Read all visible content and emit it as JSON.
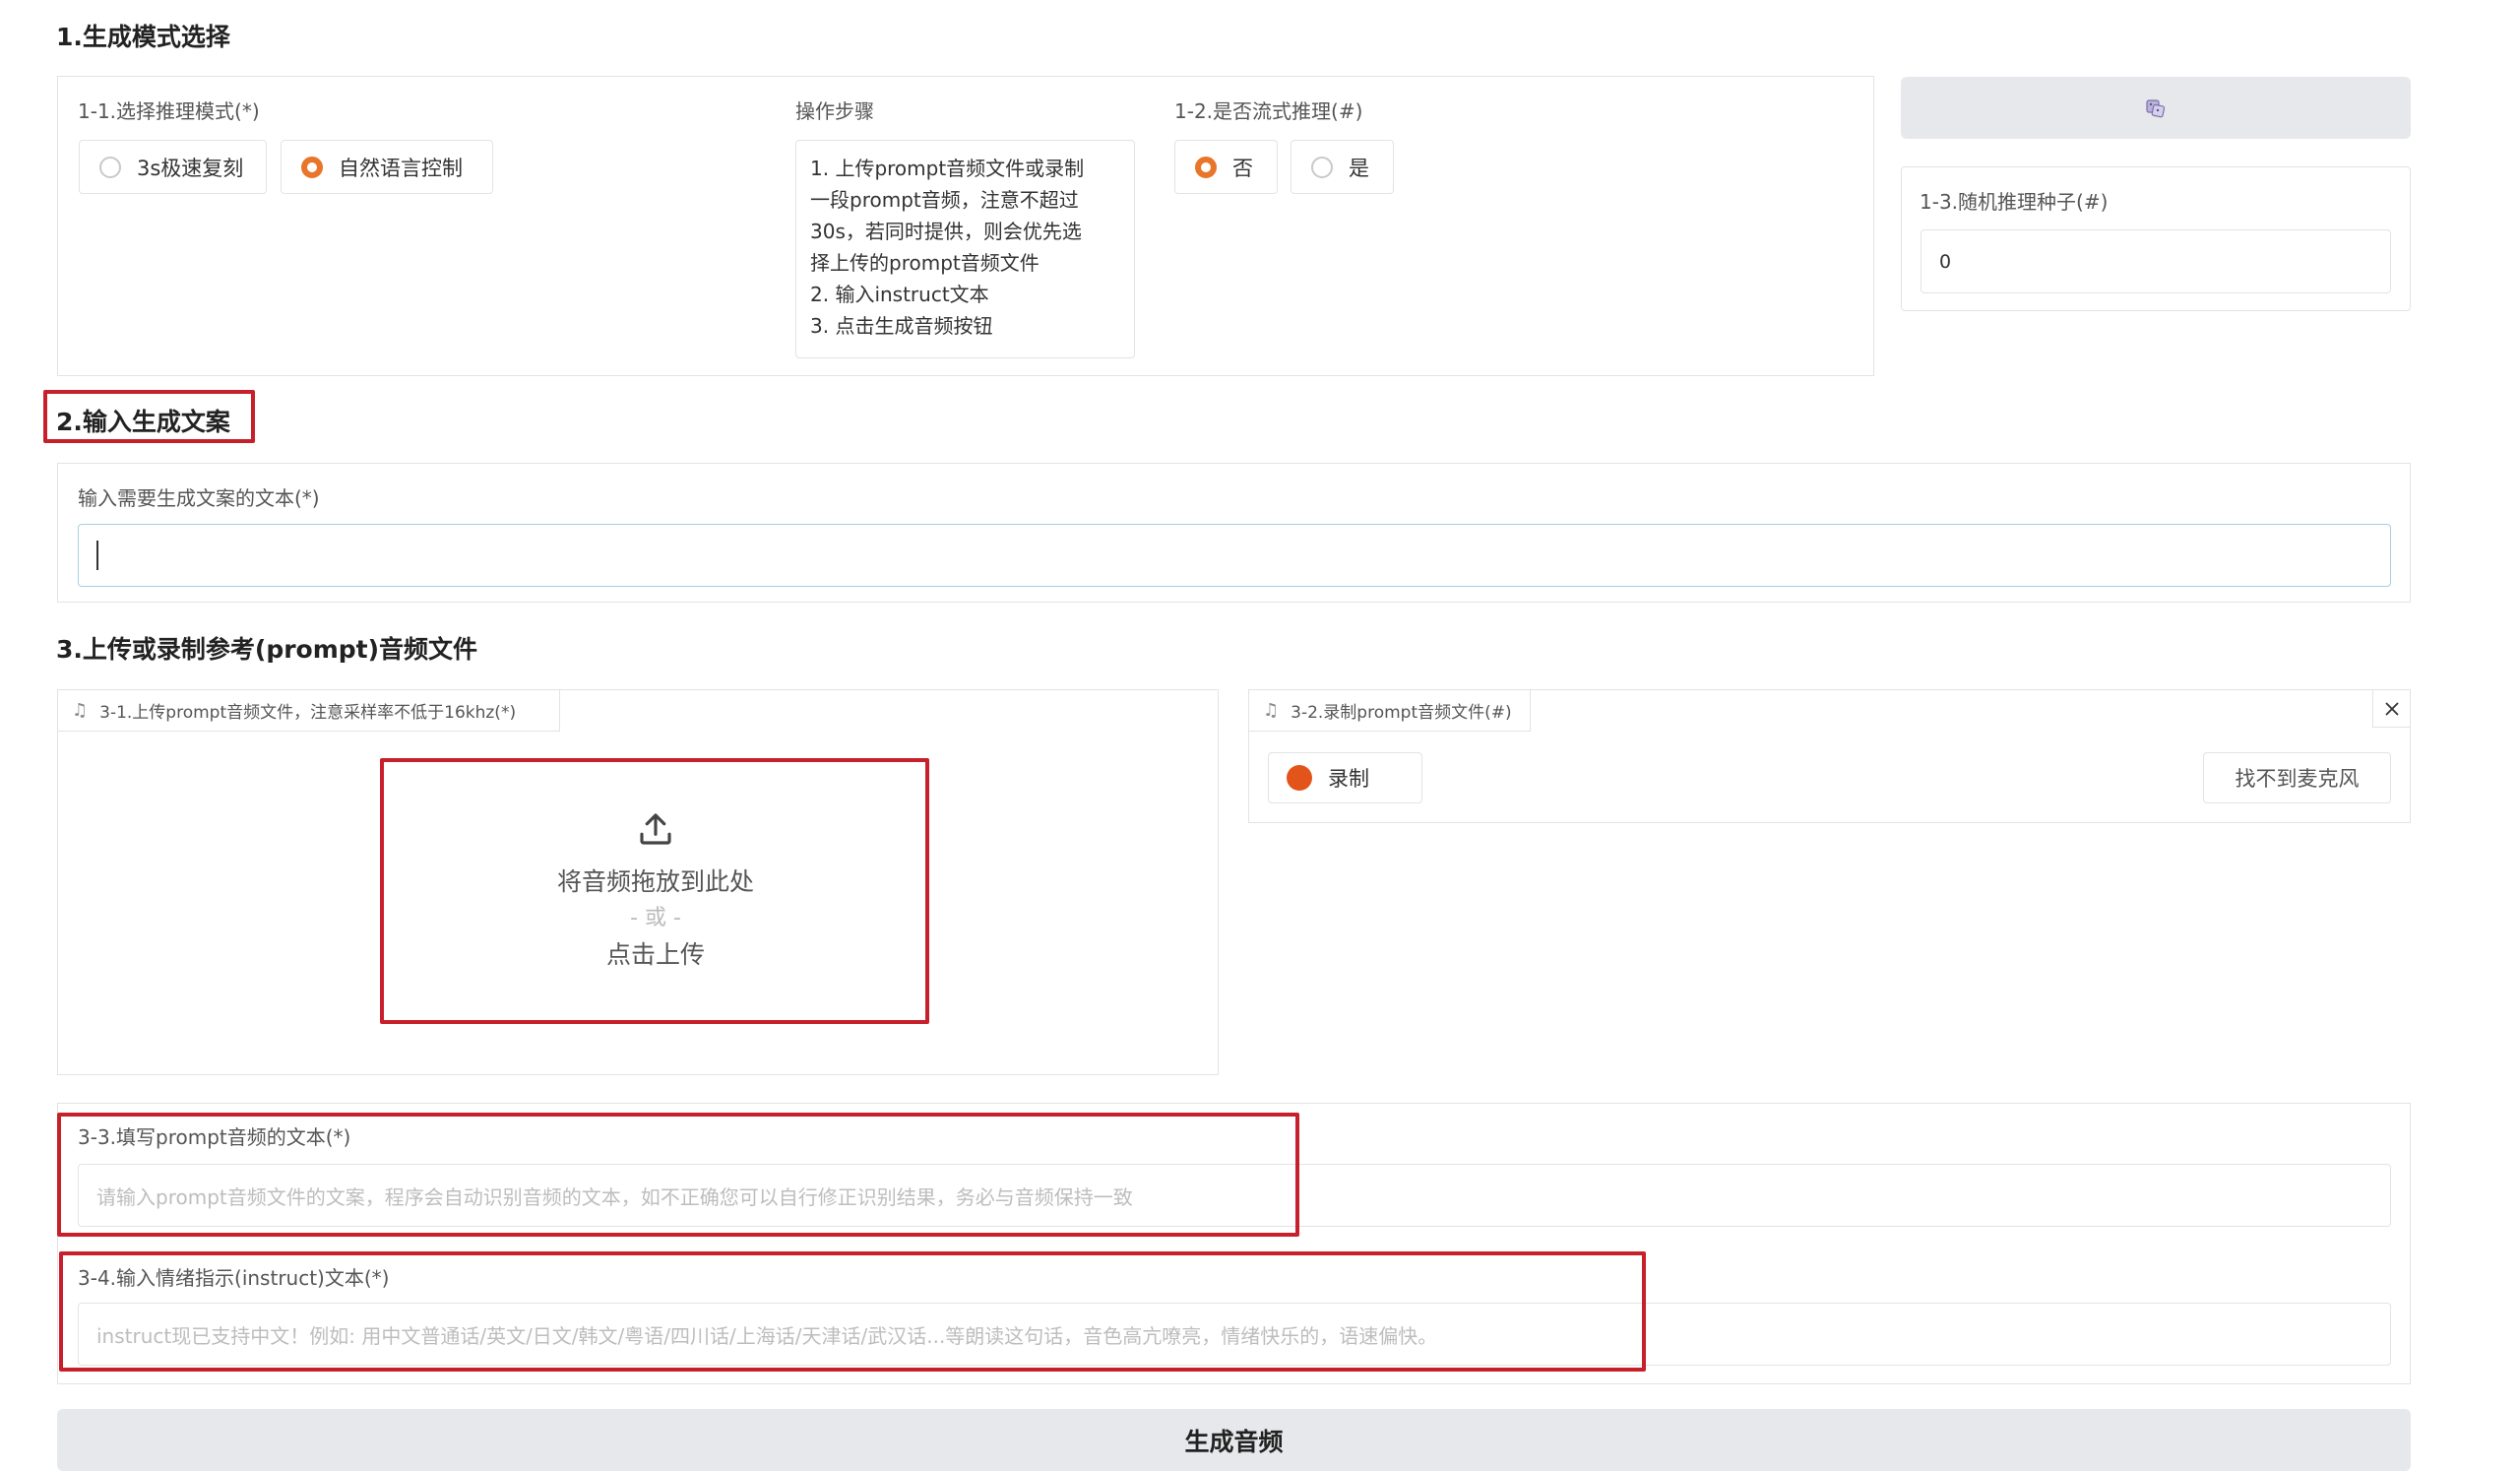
{
  "section1": {
    "title": "1.生成模式选择",
    "mode_label": "1-1.选择推理模式(*)",
    "mode_options": [
      "3s极速复刻",
      "自然语言控制"
    ],
    "mode_selected": "自然语言控制",
    "steps_label": "操作步骤",
    "steps_lines": [
      "1. 上传prompt音频文件或录制",
      "一段prompt音频，注意不超过",
      "30s，若同时提供，则会优先选",
      "择上传的prompt音频文件",
      "2. 输入instruct文本",
      "3. 点击生成音频按钮"
    ],
    "stream_label": "1-2.是否流式推理(#)",
    "stream_options": [
      "否",
      "是"
    ],
    "stream_selected": "否",
    "seed_label": "1-3.随机推理种子(#)",
    "seed_value": "0"
  },
  "section2": {
    "title": "2.输入生成文案",
    "text_label": "输入需要生成文案的文本(*)",
    "text_value": ""
  },
  "section3": {
    "title": "3.上传或录制参考(prompt)音频文件",
    "upload_tab": "3-1.上传prompt音频文件，注意采样率不低于16khz(*)",
    "upload_drop": "将音频拖放到此处",
    "upload_or": "- 或 -",
    "upload_click": "点击上传",
    "record_tab": "3-2.录制prompt音频文件(#)",
    "record_button": "录制",
    "no_mic_button": "找不到麦克风",
    "prompt_text_label": "3-3.填写prompt音频的文本(*)",
    "prompt_text_placeholder": "请输入prompt音频文件的文案，程序会自动识别音频的文本，如不正确您可以自行修正识别结果，务必与音频保持一致",
    "instruct_label": "3-4.输入情绪指示(instruct)文本(*)",
    "instruct_placeholder": "instruct现已支持中文！例如: 用中文普通话/英文/日文/韩文/粤语/四川话/上海话/天津话/武汉话...等朗读这句话，音色高亢嘹亮，情绪快乐的，语速偏快。"
  },
  "generate_button": "生成音频",
  "colors": {
    "accent": "#e8752a",
    "highlight_red": "#c8202b",
    "button_gray": "#e7e8eb"
  },
  "icons": [
    "dice-icon",
    "upload-icon",
    "music-note-icon",
    "close-icon",
    "record-dot-icon"
  ]
}
